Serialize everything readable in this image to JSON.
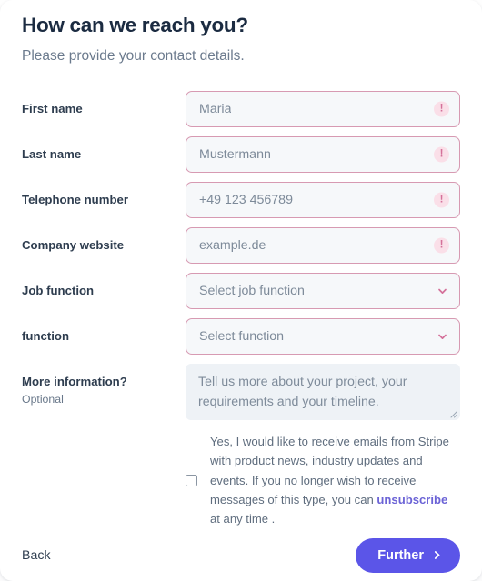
{
  "header": {
    "title": "How can we reach you?",
    "subtitle": "Please provide your contact details."
  },
  "fields": [
    {
      "label": "First name",
      "value": "Maria",
      "control": "input",
      "state": "error"
    },
    {
      "label": "Last name",
      "value": "Mustermann",
      "control": "input",
      "state": "error"
    },
    {
      "label": "Telephone number",
      "value": "+49 123 456789",
      "control": "input",
      "state": "error"
    },
    {
      "label": "Company website",
      "value": "example.de",
      "control": "input",
      "state": "error"
    },
    {
      "label": "Job function",
      "value": "Select job function",
      "control": "select",
      "state": "error"
    },
    {
      "label": "function",
      "value": "Select function",
      "control": "select",
      "state": "error"
    }
  ],
  "more_information": {
    "label": "More information?",
    "sublabel": "Optional",
    "placeholder": "Tell us more about your project, your requirements and your timeline."
  },
  "consent": {
    "checked": false,
    "text_before_link": "Yes, I would like to receive emails from Stripe with product news, industry updates and events. If you no longer wish to receive messages of this type, you can ",
    "link_text": "unsubscribe",
    "text_after_link": " at any time ."
  },
  "footer": {
    "back_label": "Back",
    "further_label": "Further"
  },
  "icons": {
    "error": "!",
    "chevron_down": "chevron-down-icon",
    "chevron_right": "chevron-right-icon"
  },
  "colors": {
    "error_border": "#d79ab2",
    "error_icon_bg": "#fadfe8",
    "error_icon_fg": "#d4719a",
    "accent": "#5b55e8",
    "link": "#6b63d6",
    "title": "#1b2b41",
    "input_bg": "#f6f8fa",
    "textarea_bg": "#eef2f6"
  }
}
